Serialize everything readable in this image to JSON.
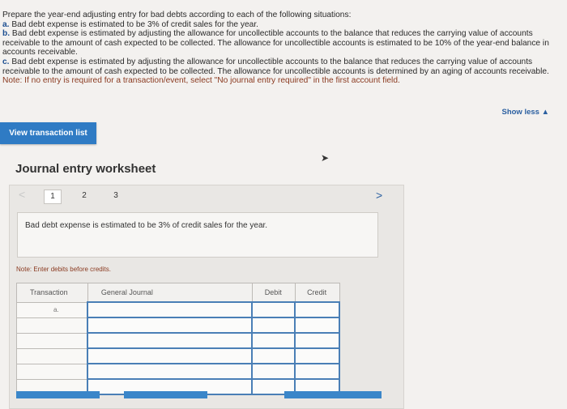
{
  "instructions": {
    "intro": "Prepare the year-end adjusting entry for bad debts according to each of the following situations:",
    "items": [
      {
        "label": "a.",
        "text": "Bad debt expense is estimated to be 3% of credit sales for the year."
      },
      {
        "label": "b.",
        "text": "Bad debt expense is estimated by adjusting the allowance for uncollectible accounts to the balance that reduces the carrying value of accounts receivable to the amount of cash expected to be collected. The allowance for uncollectible accounts is estimated to be 10% of the year-end balance in accounts receivable."
      },
      {
        "label": "c.",
        "text": "Bad debt expense is estimated by adjusting the allowance for uncollectible accounts to the balance that reduces the carrying value of accounts receivable to the amount of cash expected to be collected. The allowance for uncollectible accounts is determined by an aging of accounts receivable."
      }
    ],
    "note": "Note: If no entry is required for a transaction/event, select \"No journal entry required\" in the first account field."
  },
  "show_less": "Show less",
  "show_less_arrow": "▲",
  "view_transaction_list": "View transaction list",
  "worksheet": {
    "title": "Journal entry worksheet",
    "prev": "<",
    "next": ">",
    "pages": [
      "1",
      "2",
      "3"
    ],
    "active_page": "1",
    "description": "Bad debt expense is estimated to be 3% of credit sales for the year.",
    "note": "Note: Enter debits before credits."
  },
  "journal": {
    "headers": {
      "transaction": "Transaction",
      "general_journal": "General Journal",
      "debit": "Debit",
      "credit": "Credit"
    },
    "rows": [
      {
        "transaction": "a."
      },
      {
        "transaction": ""
      },
      {
        "transaction": ""
      },
      {
        "transaction": ""
      },
      {
        "transaction": ""
      },
      {
        "transaction": ""
      }
    ]
  },
  "colors": {
    "accent": "#2f7bc4",
    "note": "#8a3a20",
    "link": "#2a5fa0"
  }
}
